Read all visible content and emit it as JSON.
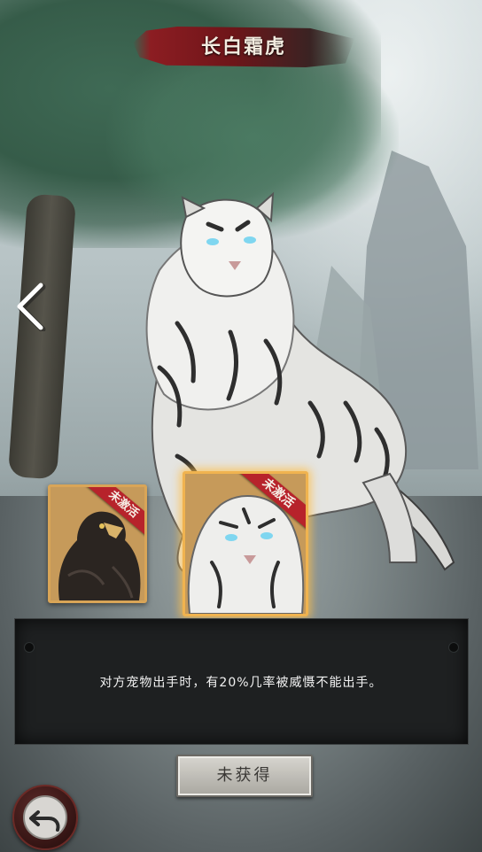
{
  "title": "长白霜虎",
  "pets": [
    {
      "name": "eagle",
      "badge": "未激活",
      "selected": false
    },
    {
      "name": "tiger",
      "badge": "未激活",
      "selected": true
    }
  ],
  "description": "对方宠物出手时，有20%几率被威慑不能出手。",
  "status_button": "未获得",
  "icons": {
    "left": "chevron-left-icon",
    "back": "back-arrow-icon"
  },
  "colors": {
    "title_banner": "#8c1d22",
    "badge": "#b7232b",
    "selected_glow": "#f0b34f"
  }
}
